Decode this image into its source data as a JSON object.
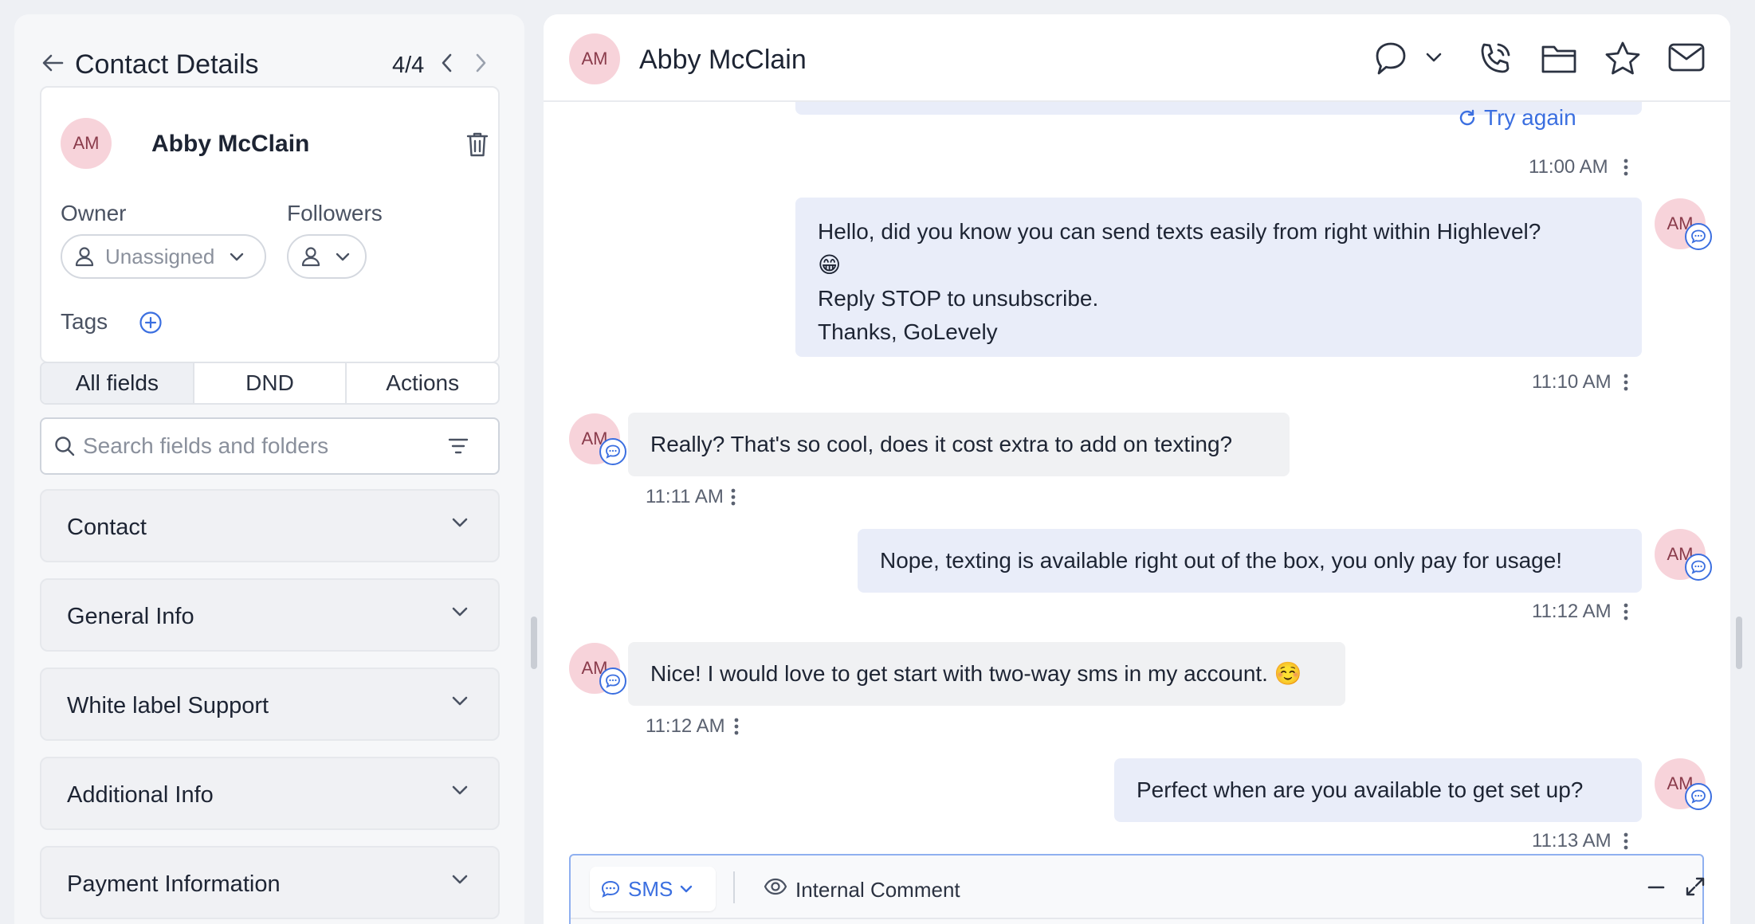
{
  "contact_panel": {
    "title": "Contact Details",
    "counter": "4/4",
    "contact": {
      "initials": "AM",
      "name": "Abby McClain"
    },
    "owner_label": "Owner",
    "owner_value": "Unassigned",
    "followers_label": "Followers",
    "tags_label": "Tags",
    "tabs": [
      "All fields",
      "DND",
      "Actions"
    ],
    "search_placeholder": "Search fields and folders",
    "sections": [
      "Contact",
      "General Info",
      "White label Support",
      "Additional Info",
      "Payment Information"
    ]
  },
  "conversation": {
    "contact_initials": "AM",
    "contact_name": "Abby McClain",
    "try_again_label": "Try again",
    "messages": [
      {
        "direction": "outbound",
        "time": "11:00 AM"
      },
      {
        "direction": "outbound",
        "lines": [
          "Hello, did you know you can send texts easily from right within Highlevel?",
          "😁",
          "Reply STOP to unsubscribe.",
          "Thanks, GoLevely"
        ],
        "time": "11:10 AM"
      },
      {
        "direction": "inbound",
        "text": "Really? That's so cool, does it cost extra to add on texting?",
        "time": "11:11 AM"
      },
      {
        "direction": "outbound",
        "text": "Nope, texting is available right out of the box, you only pay for usage!",
        "time": "11:12 AM"
      },
      {
        "direction": "inbound",
        "text": "Nice! I would love to get start with two-way sms in my account. ☺️",
        "time": "11:12 AM"
      },
      {
        "direction": "outbound",
        "text": "Perfect when are you available to get set up?",
        "time": "11:13 AM"
      }
    ],
    "composer": {
      "channel": "SMS",
      "internal_comment_label": "Internal Comment"
    }
  },
  "icons": {
    "header": [
      "chat-bubble-icon",
      "chevron-down-icon",
      "phone-icon",
      "folder-icon",
      "star-icon",
      "mail-icon"
    ],
    "accent_color": "#3b6fe0",
    "avatar_bg": "#f7d3da"
  }
}
